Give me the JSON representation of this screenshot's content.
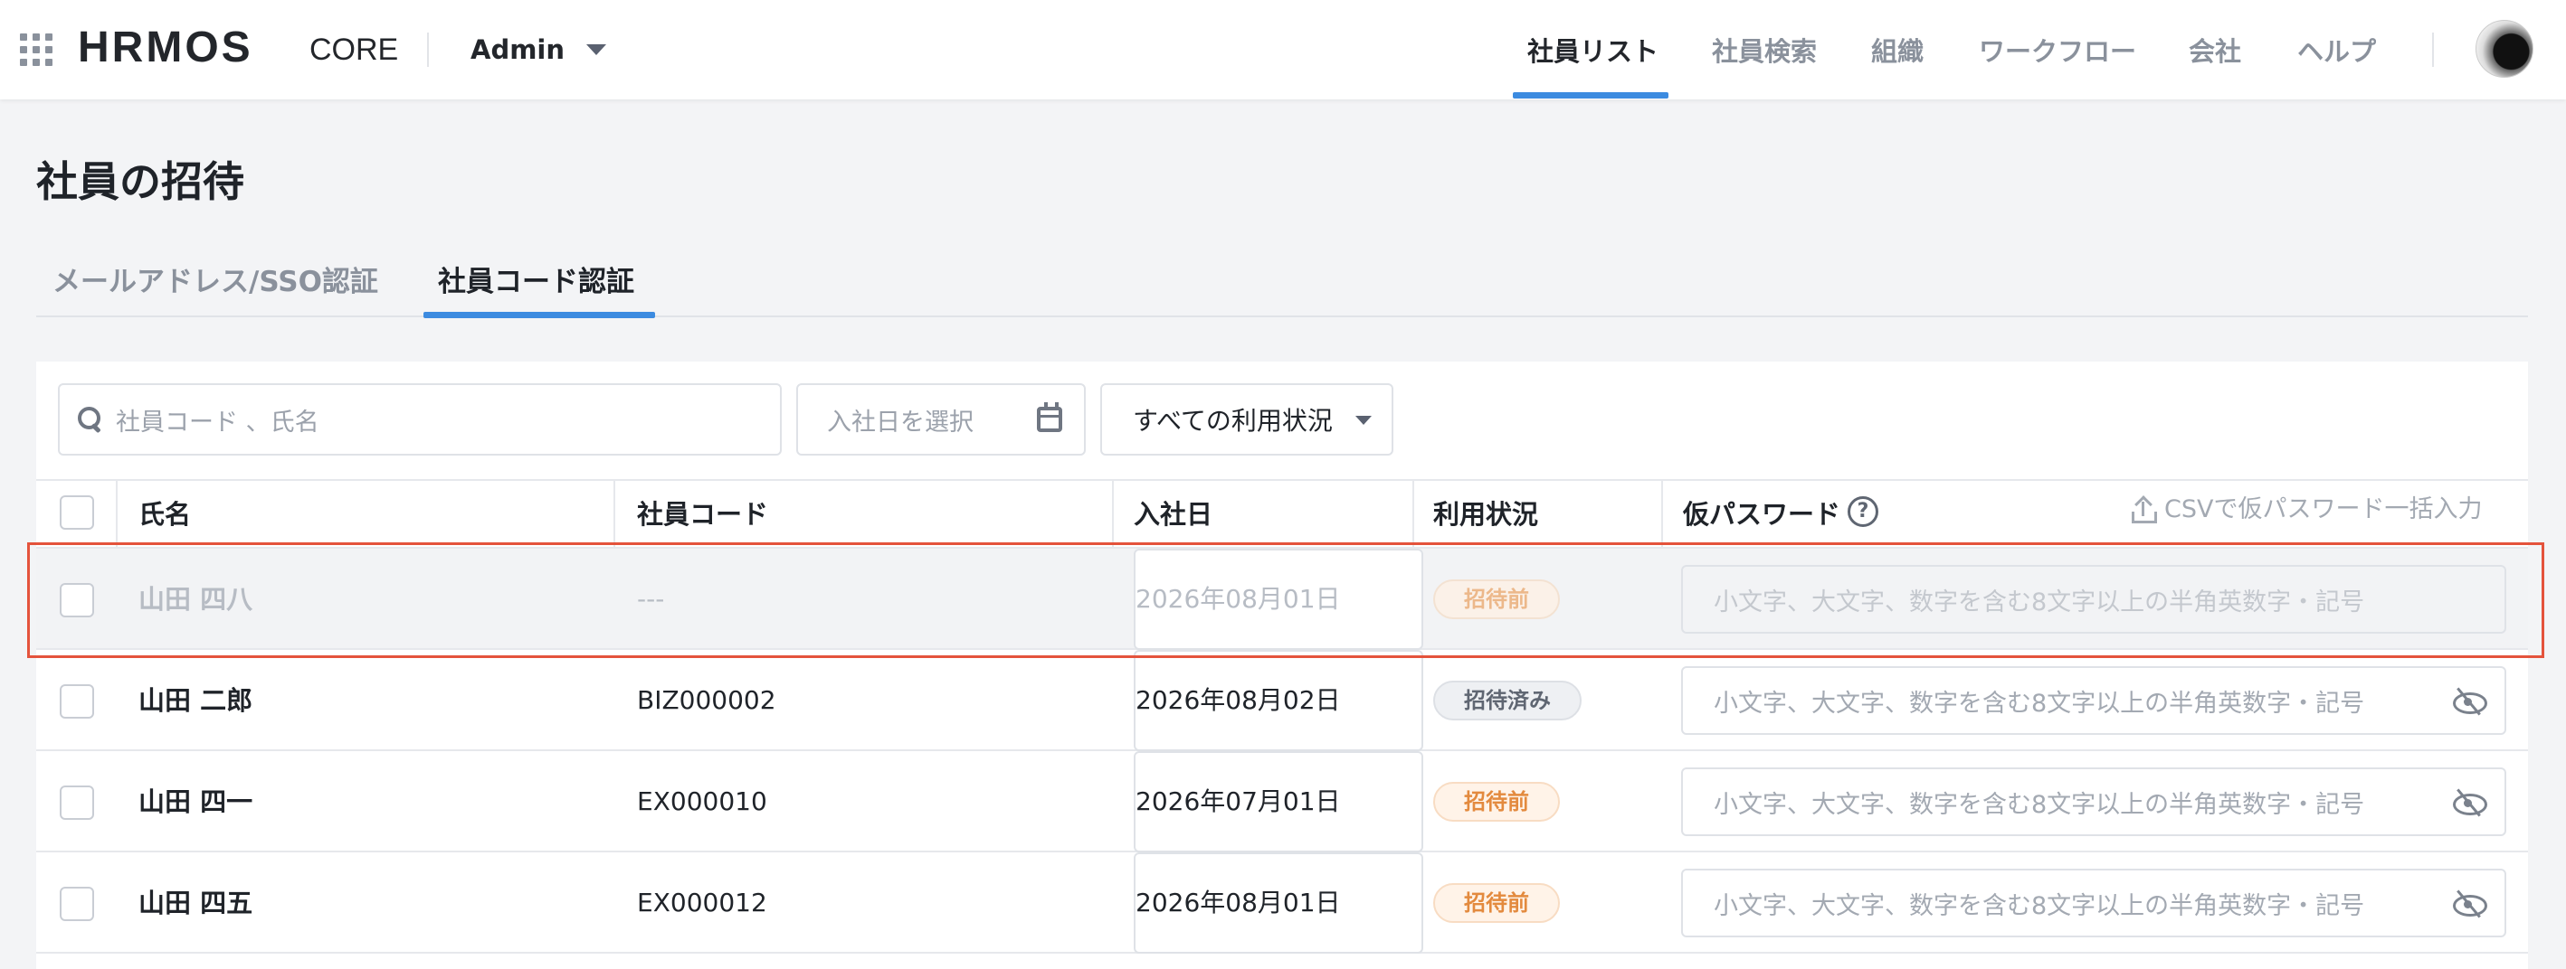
{
  "header": {
    "logo": "HRMOS",
    "logo_sub": "CORE",
    "account": "Admin",
    "nav": [
      {
        "label": "社員リスト",
        "active": true
      },
      {
        "label": "社員検索",
        "active": false
      },
      {
        "label": "組織",
        "active": false
      },
      {
        "label": "ワークフロー",
        "active": false
      },
      {
        "label": "会社",
        "active": false
      },
      {
        "label": "ヘルプ",
        "active": false
      }
    ]
  },
  "page": {
    "title": "社員の招待",
    "tabs": [
      {
        "label": "メールアドレス/SSO認証",
        "active": false
      },
      {
        "label": "社員コード認証",
        "active": true
      }
    ]
  },
  "filters": {
    "search_placeholder": "社員コード 、氏名",
    "date_placeholder": "入社日を選択",
    "status_select": "すべての利用状況"
  },
  "table": {
    "columns": [
      "氏名",
      "社員コード",
      "入社日",
      "利用状況",
      "仮パスワード"
    ],
    "csv_action": "CSVで仮パスワード一括入力",
    "password_placeholder": "小文字、大文字、数字を含む8文字以上の半角英数字・記号",
    "rows": [
      {
        "name": "山田 四八",
        "code": "---",
        "date": "2026年08月01日",
        "status": "招待前",
        "disabled": true
      },
      {
        "name": "山田 二郎",
        "code": "BIZ000002",
        "date": "2026年08月02日",
        "status": "招待済み",
        "disabled": false
      },
      {
        "name": "山田 四一",
        "code": "EX000010",
        "date": "2026年07月01日",
        "status": "招待前",
        "disabled": false
      },
      {
        "name": "山田 四五",
        "code": "EX000012",
        "date": "2026年08月01日",
        "status": "招待前",
        "disabled": false
      }
    ]
  },
  "colors": {
    "accent": "#3c8be0",
    "highlight": "#e4533c",
    "badge_pre": "#e38a3e",
    "badge_done": "#5f6672"
  }
}
